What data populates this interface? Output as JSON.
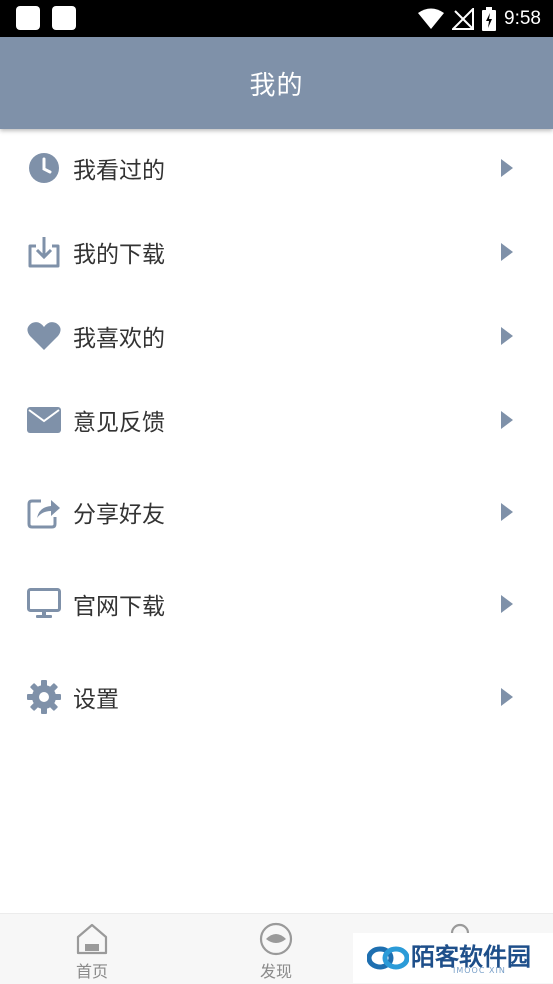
{
  "status_bar": {
    "time": "9:58",
    "icons": [
      "notification-icon",
      "notification-icon",
      "wifi-icon",
      "no-signal-icon",
      "battery-charging-icon"
    ]
  },
  "header": {
    "title": "我的"
  },
  "menu": {
    "items": [
      {
        "label": "我看过的",
        "icon": "history-clock-icon"
      },
      {
        "label": "我的下载",
        "icon": "download-icon"
      },
      {
        "label": "我喜欢的",
        "icon": "heart-icon"
      },
      {
        "label": "意见反馈",
        "icon": "envelope-icon"
      },
      {
        "label": "分享好友",
        "icon": "share-icon"
      },
      {
        "label": "官网下载",
        "icon": "monitor-icon"
      },
      {
        "label": "设置",
        "icon": "gear-icon"
      }
    ],
    "arrow_icon": "chevron-right-icon"
  },
  "tabbar": {
    "tabs": [
      {
        "label": "首页",
        "icon": "home-icon"
      },
      {
        "label": "发现",
        "icon": "discover-icon"
      }
    ]
  },
  "watermark": {
    "text": "陌客软件园",
    "sub": "IMOOC XIN"
  },
  "colors": {
    "header": "#7f91a9",
    "icon": "#7f91a9",
    "text": "#333333",
    "tab_text": "#8a8a8a"
  }
}
